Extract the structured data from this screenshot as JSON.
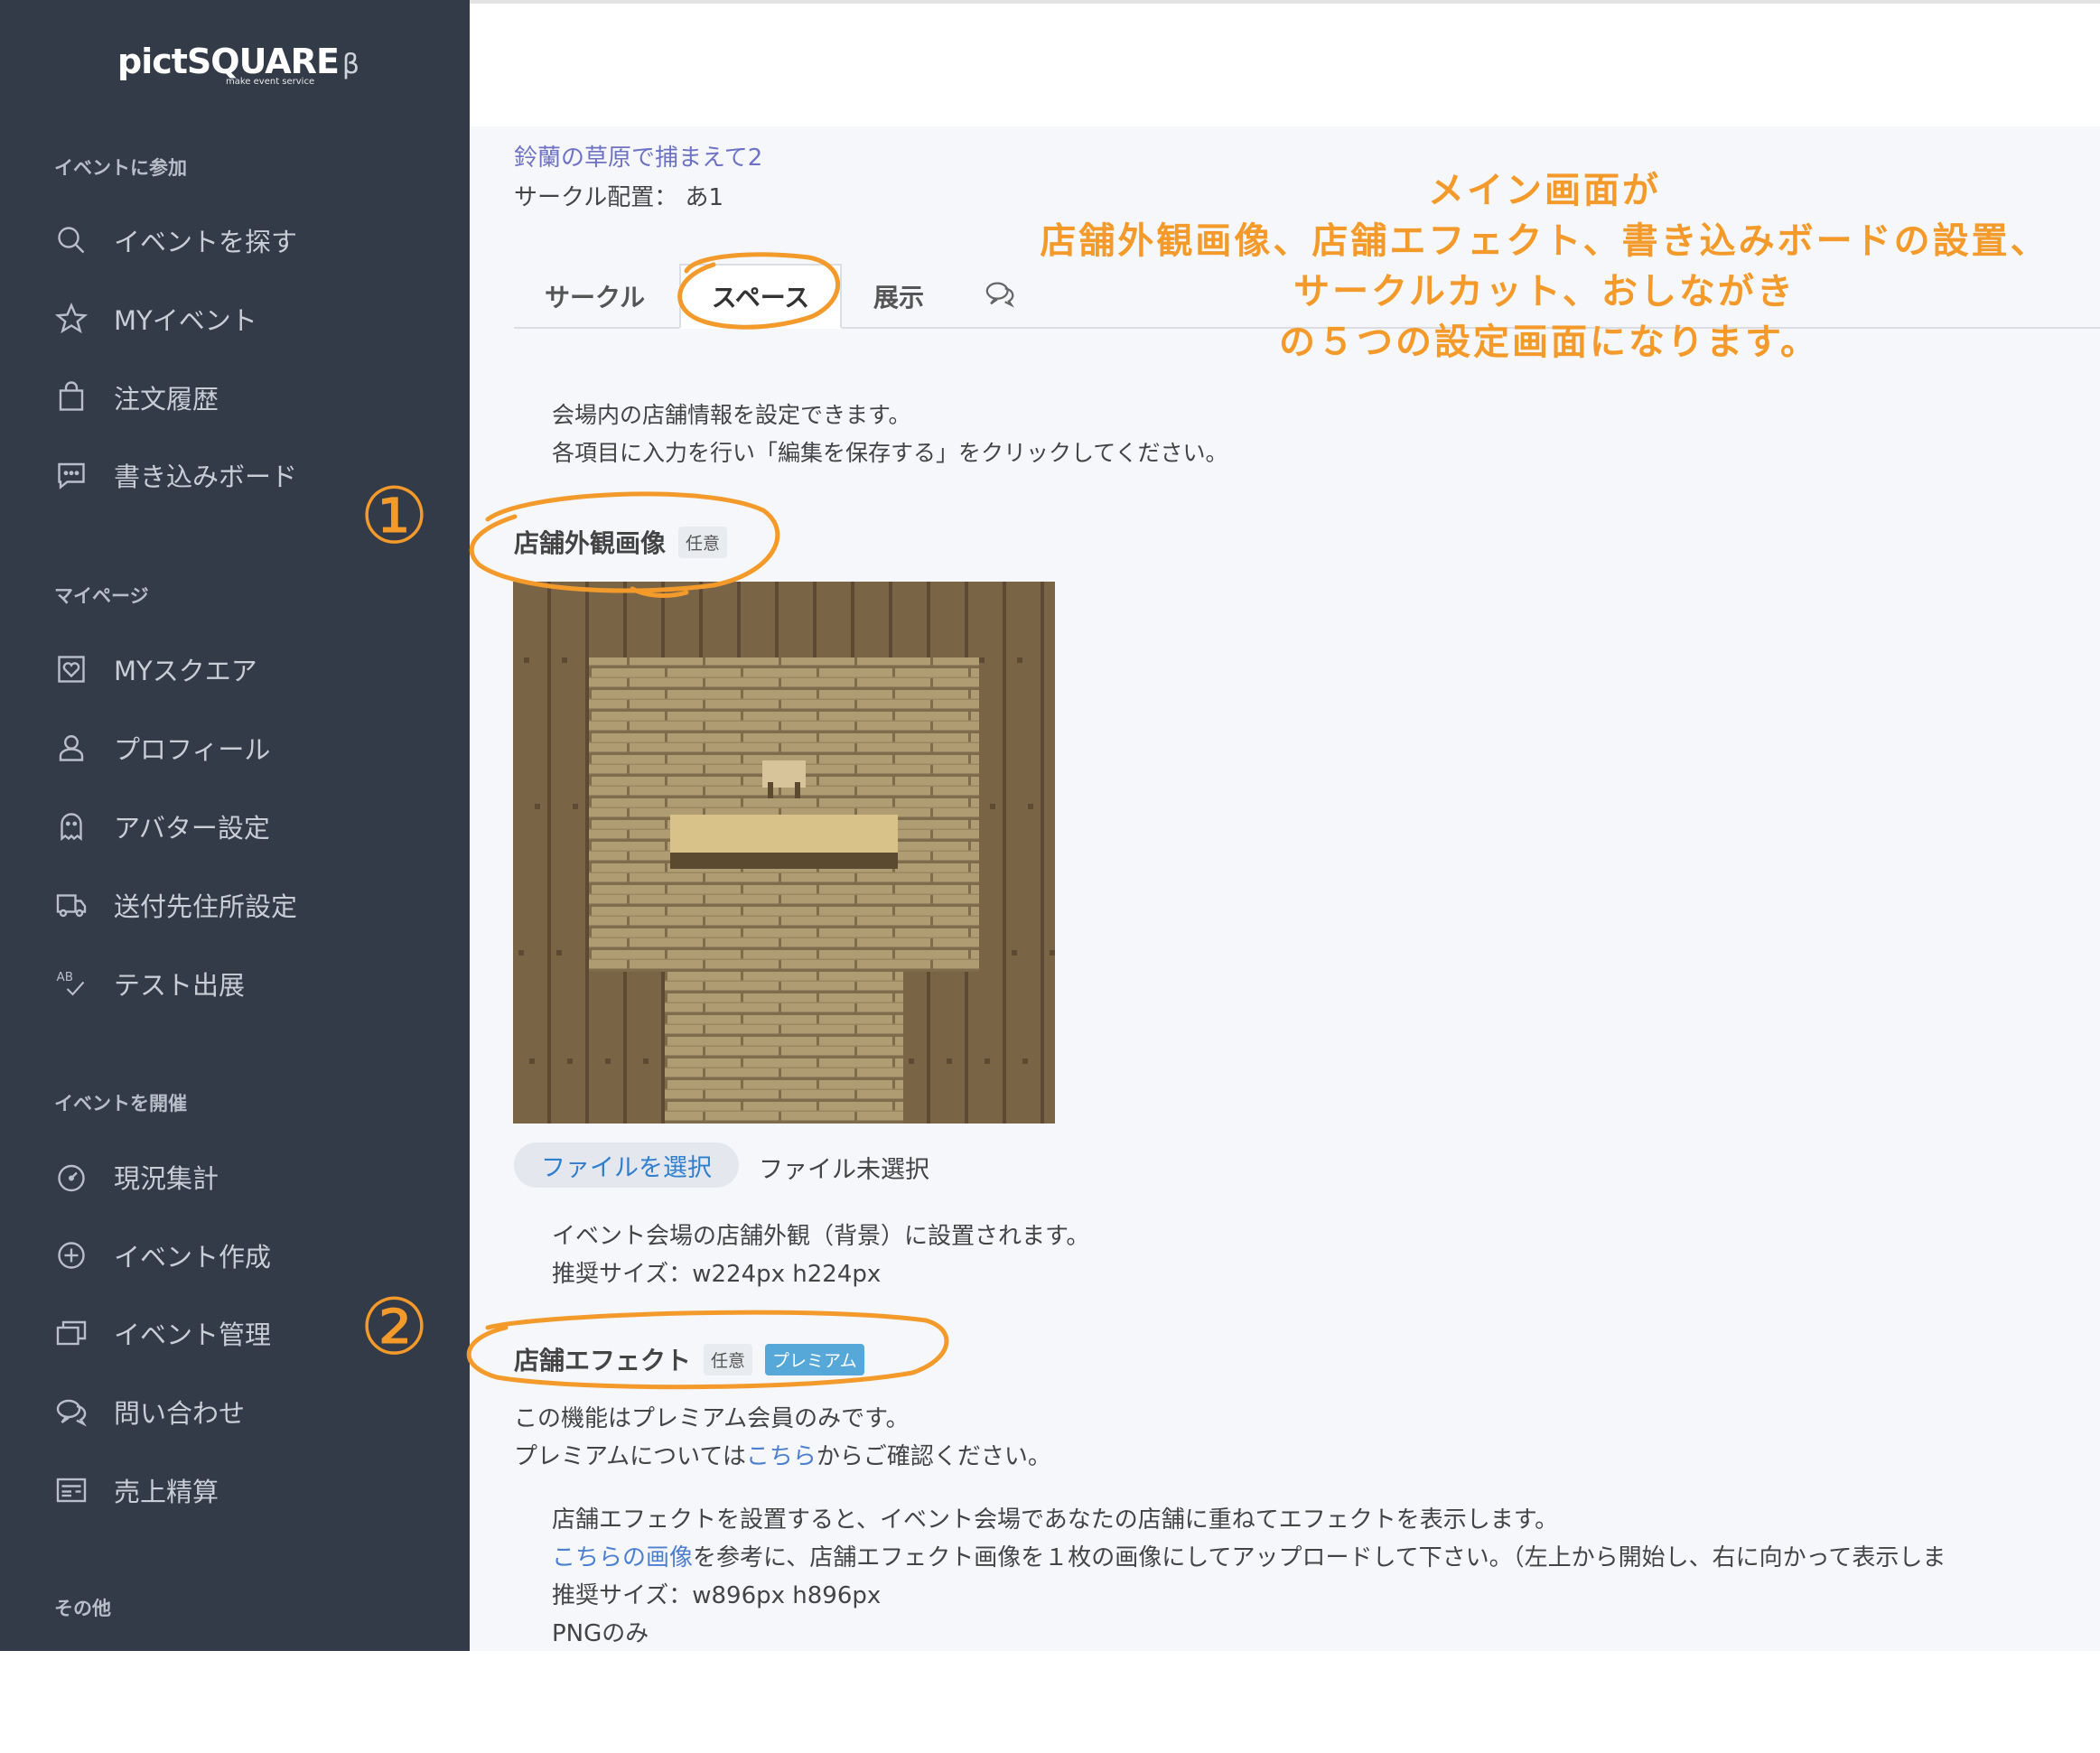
{
  "sidebar": {
    "logo": "pictSQUARE",
    "logo_beta": "β",
    "logo_sub": "make event service",
    "sections": {
      "join": "イベントに参加",
      "mypage": "マイページ",
      "host": "イベントを開催",
      "other": "その他"
    },
    "items": [
      {
        "label": "イベントを探す",
        "icon": "search-icon"
      },
      {
        "label": "MYイベント",
        "icon": "star-icon"
      },
      {
        "label": "注文履歴",
        "icon": "shopping-bag-icon"
      },
      {
        "label": "書き込みボード",
        "icon": "chat-bubble-icon"
      },
      {
        "label": "MYスクエア",
        "icon": "heart-frame-icon"
      },
      {
        "label": "プロフィール",
        "icon": "user-icon"
      },
      {
        "label": "アバター設定",
        "icon": "ghost-icon"
      },
      {
        "label": "送付先住所設定",
        "icon": "truck-icon"
      },
      {
        "label": "テスト出展",
        "icon": "ab-check-icon"
      },
      {
        "label": "現況集計",
        "icon": "gauge-icon"
      },
      {
        "label": "イベント作成",
        "icon": "plus-circle-icon"
      },
      {
        "label": "イベント管理",
        "icon": "folders-icon"
      },
      {
        "label": "問い合わせ",
        "icon": "chat-bubbles-icon"
      },
      {
        "label": "売上精算",
        "icon": "receipt-icon"
      }
    ]
  },
  "main": {
    "event_name": "鈴蘭の草原で捕まえて2",
    "circle_placement": "サークル配置： あ1",
    "tabs": [
      {
        "label": "サークル",
        "active": false
      },
      {
        "label": "スペース",
        "active": true
      },
      {
        "label": "展示",
        "active": false
      },
      {
        "label": "",
        "icon": "chat-bubbles-icon",
        "active": false
      }
    ],
    "intro": [
      "会場内の店舗情報を設定できます。",
      "各項目に入力を行い「編集を保存する」をクリックしてください。"
    ],
    "exterior": {
      "title": "店舗外観画像",
      "badge": "任意",
      "file_button": "ファイルを選択",
      "file_status": "ファイル未選択",
      "notes": [
        "イベント会場の店舗外観（背景）に設置されます。",
        "推奨サイズ：w224px h224px"
      ]
    },
    "effect": {
      "title": "店舗エフェクト",
      "badge": "任意",
      "premium_badge": "プレミアム",
      "premium_note_1": "この機能はプレミアム会員のみです。",
      "premium_note_2_pre": "プレミアムについては",
      "premium_note_2_link": "こちら",
      "premium_note_2_post": "からご確認ください。",
      "desc_1": "店舗エフェクトを設置すると、イベント会場であなたの店舗に重ねてエフェクトを表示します。",
      "desc_2_link": "こちらの画像",
      "desc_2_post": "を参考に、店舗エフェクト画像を１枚の画像にしてアップロードして下さい。（左上から開始し、右に向かって表示しま",
      "desc_3": "推奨サイズ：w896px h896px",
      "desc_4": "PNGのみ"
    }
  },
  "annotation": {
    "lines": [
      "メイン画面が",
      "店舗外観画像、店舗エフェクト、書き込みボードの設置、",
      "サークルカット、おしながき",
      "の５つの設定画面になります。"
    ],
    "marker_1": "①",
    "marker_2": "②",
    "color": "#f39a2b"
  },
  "colors": {
    "sidebar_bg": "#333a48",
    "main_bg": "#f5f7fb",
    "link": "#4d7fcf",
    "premium": "#56a8d8"
  }
}
